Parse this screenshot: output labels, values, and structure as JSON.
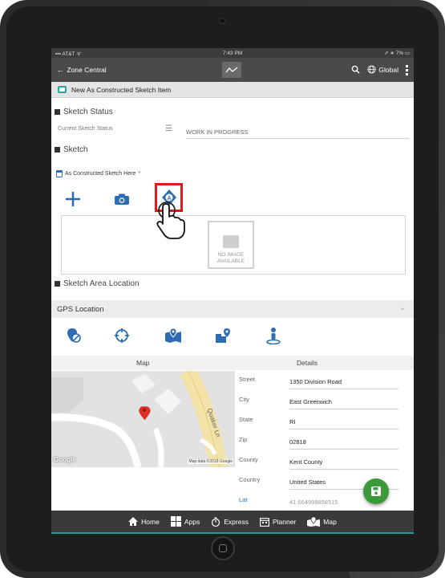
{
  "status_bar": {
    "carrier": "AT&T",
    "time": "7:43 PM",
    "battery": "7%"
  },
  "nav": {
    "back_label": "Zone Central",
    "global_label": "Global"
  },
  "title": "New As Constructed Sketch Item",
  "sketch_status": {
    "section_title": "Sketch Status",
    "field_label": "Current Sketch Status",
    "value": "WORK IN PROGRESS"
  },
  "sketch": {
    "section_title": "Sketch",
    "field_label": "As Constructed Sketch Here",
    "required_mark": "*",
    "no_image_line1": "NO IMAGE",
    "no_image_line2": "AVAILABLE"
  },
  "area_location": {
    "section_title": "Sketch Area Location"
  },
  "gps": {
    "title": "GPS Location"
  },
  "columns": {
    "map": "Map",
    "details": "Details"
  },
  "map": {
    "google": "Google",
    "attribution": "Map data ©2018 Google",
    "street_label": "Quaker Ln"
  },
  "details": [
    {
      "key": "Street",
      "value": "1350 Division Road"
    },
    {
      "key": "City",
      "value": "East Greenwich"
    },
    {
      "key": "State",
      "value": "RI"
    },
    {
      "key": "Zip",
      "value": "02818"
    },
    {
      "key": "County",
      "value": "Kent County"
    },
    {
      "key": "Country",
      "value": "United States"
    },
    {
      "key": "Lat",
      "value": "41.664999858515"
    }
  ],
  "tabs": [
    {
      "label": "Home",
      "icon": "home-icon"
    },
    {
      "label": "Apps",
      "icon": "apps-icon"
    },
    {
      "label": "Express",
      "icon": "stopwatch-icon"
    },
    {
      "label": "Planner",
      "icon": "calendar-icon"
    },
    {
      "label": "Map",
      "icon": "map-icon"
    }
  ],
  "colors": {
    "accent_blue": "#2e6db4",
    "highlight_red": "#e01818",
    "fab_green": "#3a9a3a",
    "teal": "#2aa4a4"
  }
}
